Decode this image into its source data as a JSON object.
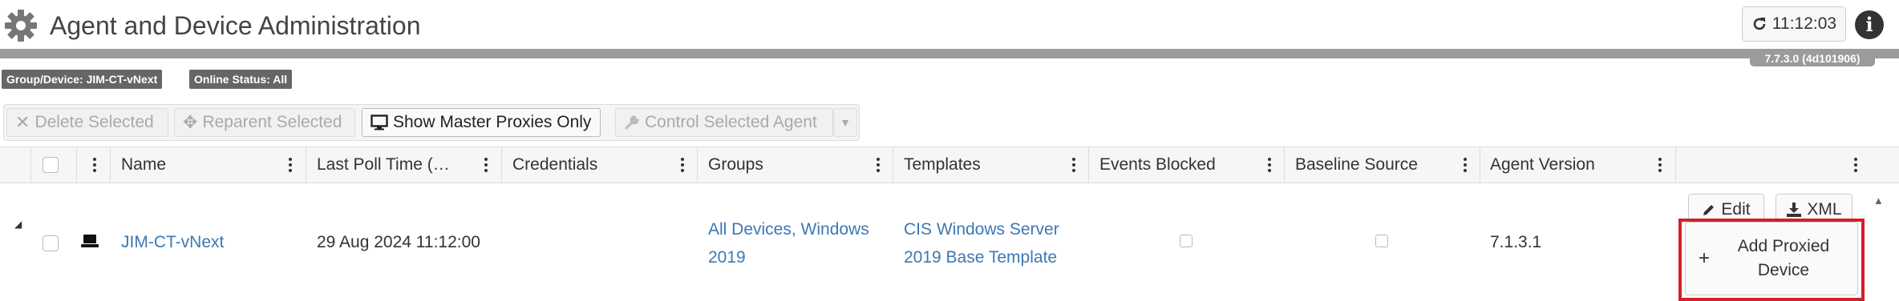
{
  "header": {
    "title": "Agent and Device Administration",
    "time": "11:12:03",
    "version": "7.7.3.0 (4d101906)"
  },
  "filters": {
    "group_device": "Group/Device: JIM-CT-vNext",
    "online_status": "Online Status: All"
  },
  "toolbar": {
    "delete_label": "Delete Selected",
    "reparent_label": "Reparent Selected",
    "master_label": "Show Master Proxies Only",
    "control_label": "Control Selected Agent"
  },
  "grid": {
    "columns": {
      "name": "Name",
      "last_poll": "Last Poll Time (…",
      "credentials": "Credentials",
      "groups": "Groups",
      "templates": "Templates",
      "events_blocked": "Events Blocked",
      "baseline_source": "Baseline Source",
      "agent_version": "Agent Version"
    },
    "row": {
      "name": "JIM-CT-vNext",
      "last_poll": "29 Aug 2024 11:12:00",
      "credentials": "",
      "groups_line1": "All Devices, Windows",
      "groups_line2": "2019",
      "templates_line1": "CIS Windows Server",
      "templates_line2": "2019 Base Template",
      "agent_version": "7.1.3.1"
    },
    "actions": {
      "edit": "Edit",
      "xml": "XML",
      "add_proxied_line1": "Add Proxied",
      "add_proxied_line2": "Device"
    }
  },
  "colors": {
    "link": "#3c78b4",
    "highlight": "#d32027",
    "chip": "#666666"
  },
  "icons": [
    "gear-icon",
    "refresh-icon",
    "info-icon",
    "close-icon",
    "move-icon",
    "monitor-icon",
    "wrench-icon",
    "caret-down-icon",
    "menu-dots-icon",
    "expand-caret-icon",
    "device-icon",
    "pencil-icon",
    "download-icon",
    "plus-icon",
    "scroll-up-icon"
  ]
}
